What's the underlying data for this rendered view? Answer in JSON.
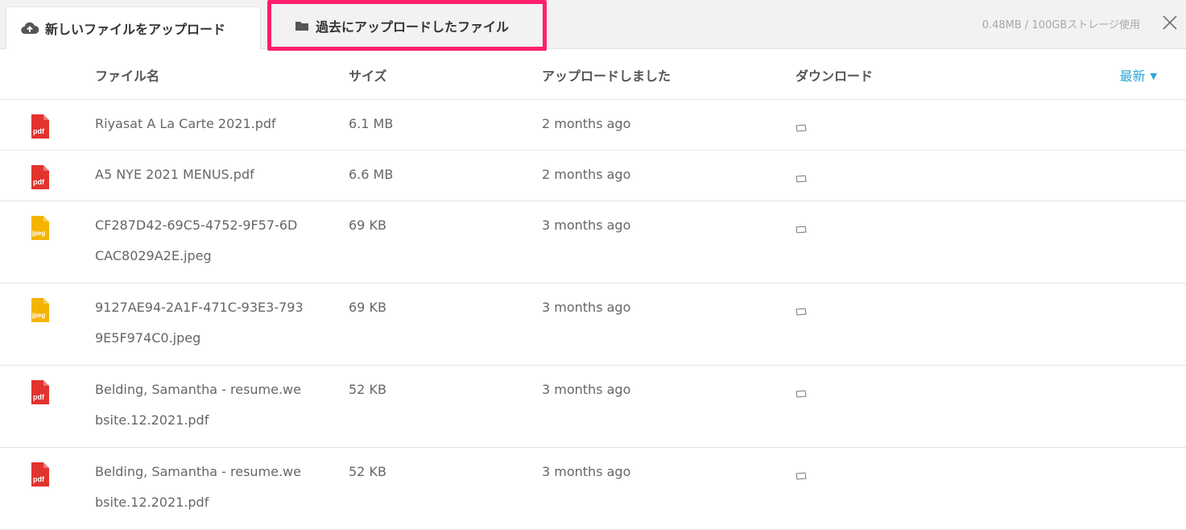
{
  "tabs": {
    "upload_label": "新しいファイルをアップロード",
    "past_label": "過去にアップロードしたファイル"
  },
  "storage_text": "0.48MB / 100GBストレージ使用",
  "table": {
    "headers": {
      "name": "ファイル名",
      "size": "サイズ",
      "uploaded": "アップロードしました",
      "download": "ダウンロード"
    },
    "sort_label": "最新",
    "rows": [
      {
        "type": "pdf",
        "name": "Riyasat A La Carte 2021.pdf",
        "size": "6.1 MB",
        "uploaded": "2 months ago"
      },
      {
        "type": "pdf",
        "name": "A5 NYE 2021 MENUS.pdf",
        "size": "6.6 MB",
        "uploaded": "2 months ago"
      },
      {
        "type": "jpeg",
        "name": "CF287D42-69C5-4752-9F57-6DCAC8029A2E.jpeg",
        "size": "69 KB",
        "uploaded": "3 months ago"
      },
      {
        "type": "jpeg",
        "name": "9127AE94-2A1F-471C-93E3-7939E5F974C0.jpeg",
        "size": "69 KB",
        "uploaded": "3 months ago"
      },
      {
        "type": "pdf",
        "name": "Belding, Samantha - resume.website.12.2021.pdf",
        "size": "52 KB",
        "uploaded": "3 months ago"
      },
      {
        "type": "pdf",
        "name": "Belding, Samantha - resume.website.12.2021.pdf",
        "size": "52 KB",
        "uploaded": "3 months ago"
      }
    ]
  },
  "colors": {
    "pdf": "#e2332f",
    "jpeg": "#f5b400",
    "accent": "#2aa6d6",
    "highlight": "#ff1f6f"
  }
}
